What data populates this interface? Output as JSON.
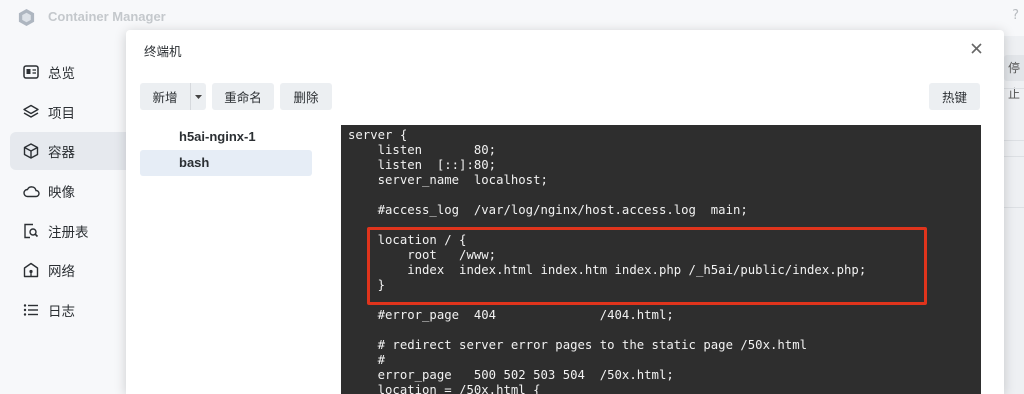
{
  "app": {
    "title": "Container Manager",
    "help_glyph": "?",
    "accent_color": "#6a8fc7"
  },
  "sidebar": {
    "items": [
      {
        "label": "总览",
        "icon": "overview-icon"
      },
      {
        "label": "项目",
        "icon": "layers-icon"
      },
      {
        "label": "容器",
        "icon": "cube-icon",
        "active": true
      },
      {
        "label": "映像",
        "icon": "cloud-icon"
      },
      {
        "label": "注册表",
        "icon": "registry-search-icon"
      },
      {
        "label": "网络",
        "icon": "network-home-icon"
      },
      {
        "label": "日志",
        "icon": "list-icon"
      }
    ]
  },
  "background": {
    "stop_button_label": "停止"
  },
  "dialog": {
    "title": "终端机",
    "toolbar": {
      "add_label": "新增",
      "rename_label": "重命名",
      "delete_label": "删除",
      "hotkeys_label": "热键"
    },
    "sessions": [
      {
        "label": "h5ai-nginx-1",
        "selected": false
      },
      {
        "label": "bash",
        "selected": true
      }
    ],
    "terminal": {
      "lines": [
        "server {",
        "    listen       80;",
        "    listen  [::]:80;",
        "    server_name  localhost;",
        "",
        "    #access_log  /var/log/nginx/host.access.log  main;",
        "",
        "    location / {",
        "        root   /www;",
        "        index  index.html index.htm index.php /_h5ai/public/index.php;",
        "    }",
        "",
        "    #error_page  404              /404.html;",
        "",
        "    # redirect server error pages to the static page /50x.html",
        "    #",
        "    error_page   500 502 503 504  /50x.html;",
        "    location = /50x.html {"
      ],
      "highlight_color": "#e0341c"
    }
  }
}
